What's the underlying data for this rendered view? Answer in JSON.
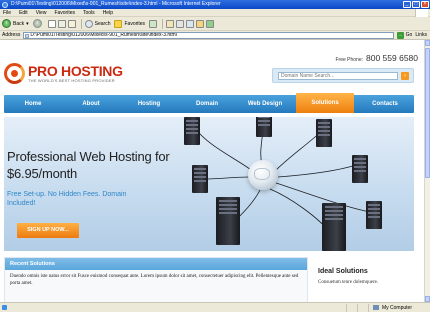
{
  "window": {
    "title": "D:\\Pumi01\\Testing\\012006\\Mixed\\s-901_Rumesh\\site\\index-3.html - Microsoft Internet Explorer"
  },
  "menu": [
    "File",
    "Edit",
    "View",
    "Favorites",
    "Tools",
    "Help"
  ],
  "toolbar": {
    "back": "Back",
    "search": "Search",
    "favorites": "Favorites"
  },
  "address": {
    "label": "Address",
    "value": "D:\\Pumi01\\Testing\\012006\\Mixed\\s-901_Rumesh\\site\\index-3.html",
    "go": "Go",
    "links": "Links"
  },
  "header": {
    "logo_name": "PRO HOSTING",
    "logo_tagline": "THE WORLD'S BEST HOSTING PROVIDER",
    "phone_label": "Free Phone:",
    "phone_number": "800 559 6580",
    "search_placeholder": "Domain Name Search..."
  },
  "nav": {
    "items": [
      "Home",
      "About",
      "Hosting",
      "Domain",
      "Web Design",
      "Solutions",
      "Contacts"
    ],
    "active": "Solutions"
  },
  "hero": {
    "title": "Professional Web Hosting for $6.95/month",
    "subtitle": "Free Set-up. No Hidden Fees. Domain Included!",
    "cta": "SIGN UP NOW..."
  },
  "recent": {
    "heading": "Recent Solutions",
    "body": "Duendo omnis iste natus error sit Fusce euismod consequat ante. Lorem ipsum dolor sit amet, consectetuer adipiscing elit. Pellentesque ante sed porta amet."
  },
  "ideal": {
    "heading": "Ideal Solutions",
    "body": "Consuetum tenre dolemquere."
  },
  "status": {
    "text": "",
    "zone": "My Computer"
  },
  "colors": {
    "brand_red": "#cc2a10",
    "nav_blue": "#2f86c9",
    "accent_orange": "#f08a1c",
    "subtitle_blue": "#2f86c9"
  }
}
